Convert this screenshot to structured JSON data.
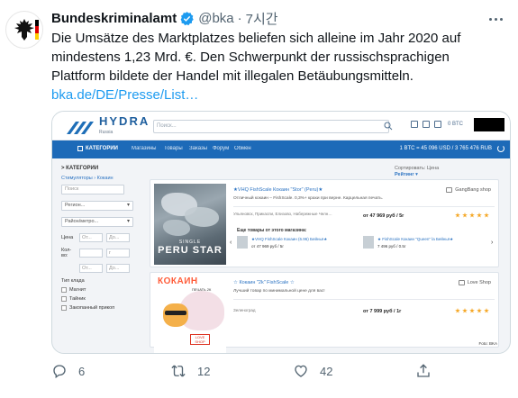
{
  "tweet": {
    "display_name": "Bundeskriminalamt",
    "handle": "@bka",
    "separator": "·",
    "time": "7시간",
    "text_main": "Die Umsätze des Marktplatzes beliefen sich alleine im Jahr 2020 auf mindestens 1,23 Mrd. €. Den Schwerpunkt der russischsprachigen Plattform bildete der Handel mit illegalen Betäubungsmitteln.",
    "link_text": "bka.de/DE/Presse/List…",
    "actions": {
      "replies": "6",
      "retweets": "12",
      "likes": "42"
    },
    "flag_colors": [
      "#000000",
      "#dd0000",
      "#ffce00"
    ],
    "icons": [
      "verified-badge-icon",
      "more-icon",
      "reply-icon",
      "retweet-icon",
      "like-icon",
      "share-icon"
    ]
  },
  "screenshot": {
    "logo": "HYDRA",
    "logo_sub": "Russia",
    "search_placeholder": "Поиск...",
    "btc": "0 BTC",
    "nav": {
      "category": "КАТЕГОРИИ",
      "items": [
        "Магазины",
        "Товары",
        "Заказы",
        "Форум",
        "Обмен"
      ],
      "rate": "1 BTC = 45 096 USD / 3 765 476 RUB"
    },
    "sort": {
      "label": "Сортировать:",
      "active": "Рейтинг ▾",
      "other": "Цена"
    },
    "sidebar": {
      "title": "> КАТЕГОРИИ",
      "breadcrumb": "Стимуляторы › Кокаин",
      "search": "Поиск",
      "region": "Регион...",
      "district": "Район/метро...",
      "price_label": "Цена",
      "from": "От...",
      "to": "До...",
      "qty_label": "Кол-во:",
      "qty_unit": "г",
      "type_label": "Тип клада",
      "options": [
        "Магнит",
        "Тайник",
        "Закопанный прикоп"
      ]
    },
    "product1": {
      "title": "★VHQ FishScale Кокаин \"Stor\" (Peru)★",
      "desc": "Отличный кокаин – FishScale. 0,3%+ крахи при верне. Карцельная печать.",
      "shop": "GangBang shop",
      "location": "Ульяновск, Прикаспи, Елизово, Набережные Челн…",
      "price": "от 47 969 руб / 5г",
      "image_caption_small": "SINGLE",
      "image_caption": "PERU STAR",
      "also_label": "Еще товары от этого магазина:",
      "also1_title": "★VHQ FishScale Кокаин (6.96) Бейнья★",
      "also1_price": "от 47 969 руб / 5г",
      "also2_title": "★ FishScale Кокаин \"Queen\" la Бейнья★",
      "also2_price": "7 496 руб / 0.5г"
    },
    "product2": {
      "title": "☆ Кокаин \"2k\" FishScale ☆",
      "desc": "Лучший товар по минимальной цене для вас!",
      "shop": "Love Shop",
      "location": "Зеленоград",
      "price": "от 7 999 руб / 1г",
      "image_title": "КОКАИН",
      "image_sub": "ПЕЧАТЬ 2К",
      "image_badge": "LOVE SHOP"
    },
    "credit": "Foto: BKA"
  }
}
